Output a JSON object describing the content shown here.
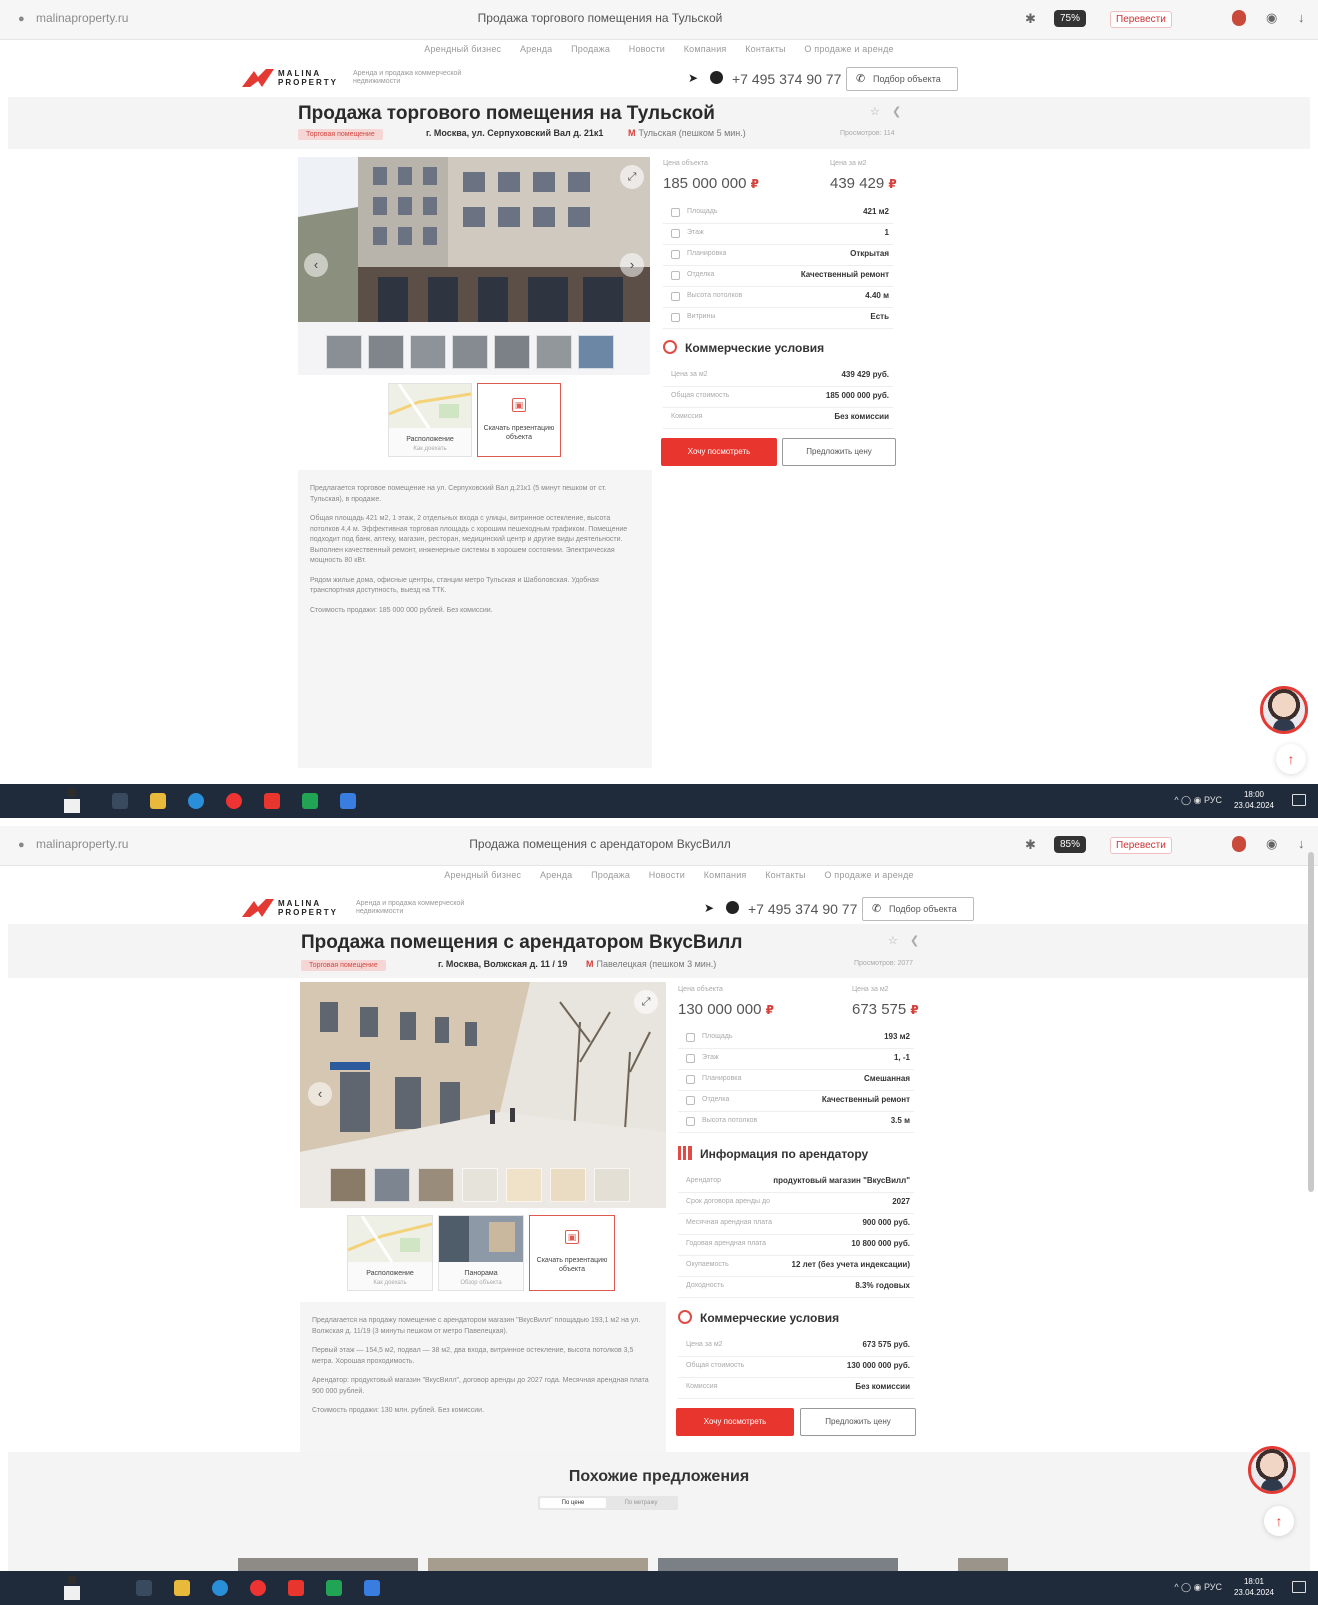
{
  "colors": {
    "accent": "#e8362f",
    "badge_bg": "#f6d6d4",
    "taskbar": "#1f2b3b"
  },
  "nav": [
    "Арендный бизнес",
    "Аренда",
    "Продажа",
    "Новости",
    "Компания",
    "Контакты",
    "О продаже и аренде"
  ],
  "site": {
    "logo_text": "MALINA PROPERTY",
    "tagline": "Аренда и продажа коммерческой недвижимости",
    "phone": "+7 495 374 90 77",
    "pick_button": "Подбор объекта"
  },
  "shot1": {
    "url": "malinaproperty.ru",
    "tab_title": "Продажа торгового помещения на Тульской",
    "perf": "75%",
    "translate": "Перевести",
    "title": "Продажа торгового помещения на Тульской",
    "type_badge": "Торговая помещение",
    "address": "г. Москва, ул. Серпуховский Вал д. 21к1",
    "metro": "Тульская (пешком 5 мин.)",
    "views": "Просмотров: 114",
    "price_label": "Цена объекта",
    "price": "185 000 000",
    "price_m2_label": "Цена за м2",
    "price_m2": "439 429",
    "rows": [
      {
        "k": "Площадь",
        "v": "421 м2"
      },
      {
        "k": "Этаж",
        "v": "1"
      },
      {
        "k": "Планировка",
        "v": "Открытая"
      },
      {
        "k": "Отделка",
        "v": "Качественный ремонт"
      },
      {
        "k": "Высота потолков",
        "v": "4.40 м"
      },
      {
        "k": "Витрины",
        "v": "Есть"
      }
    ],
    "commercial_title": "Коммерческие условия",
    "commercial": [
      {
        "k": "Цена за м2",
        "v": "439 429 руб."
      },
      {
        "k": "Общая стоимость",
        "v": "185 000 000 руб."
      },
      {
        "k": "Комиссия",
        "v": "Без комиссии"
      }
    ],
    "view_button": "Хочу посмотреть",
    "offer_button": "Предложить цену",
    "card_location": "Расположение",
    "card_location_sub": "Как доехать",
    "card_presentation": "Скачать презентацию объекта",
    "desc": [
      "Предлагается торговое помещение на ул. Серпуховский Вал д.21к1 (5 минут пешком от ст. Тульская), в продаже.",
      "Общая площадь 421 м2, 1 этаж, 2 отдельных входа с улицы, витринное остекление, высота потолков 4,4 м. Эффективная торговая площадь с хорошим пешеходным трафиком. Помещение подходит под банк, аптеку, магазин, ресторан, медицинский центр и другие виды деятельности. Выполнен качественный ремонт, инженерные системы в хорошем состоянии. Электрическая мощность 80 кВт.",
      "Рядом жилые дома, офисные центры, станции метро Тульская и Шаболовская. Удобная транспортная доступность, выезд на ТТК.",
      "Стоимость продажи: 185 000 000 рублей. Без комиссии."
    ],
    "tray": "РУС",
    "clock_time": "18:00",
    "clock_date": "23.04.2024"
  },
  "shot2": {
    "url": "malinaproperty.ru",
    "tab_title": "Продажа помещения с арендатором ВкусВилл",
    "perf": "85%",
    "translate": "Перевести",
    "title": "Продажа помещения с арендатором ВкусВилл",
    "type_badge": "Торговая помещение",
    "address": "г. Москва, Волжская д. 11 / 19",
    "metro": "Павелецкая (пешком 3 мин.)",
    "views": "Просмотров: 2077",
    "price_label": "Цена объекта",
    "price": "130 000 000",
    "price_m2_label": "Цена за м2",
    "price_m2": "673 575",
    "rows": [
      {
        "k": "Площадь",
        "v": "193 м2"
      },
      {
        "k": "Этаж",
        "v": "1, -1"
      },
      {
        "k": "Планировка",
        "v": "Смешанная"
      },
      {
        "k": "Отделка",
        "v": "Качественный ремонт"
      },
      {
        "k": "Высота потолков",
        "v": "3.5 м"
      }
    ],
    "tenant_title": "Информация по арендатору",
    "tenant": [
      {
        "k": "Арендатор",
        "v": "продуктовый магазин \"ВкусВилл\""
      },
      {
        "k": "Срок договора аренды до",
        "v": "2027"
      },
      {
        "k": "Месячная арендная плата",
        "v": "900 000 руб."
      },
      {
        "k": "Годовая арендная плата",
        "v": "10 800 000 руб."
      },
      {
        "k": "Окупаемость",
        "v": "12 лет (без учета индексации)"
      },
      {
        "k": "Доходность",
        "v": "8.3% годовых"
      }
    ],
    "commercial_title": "Коммерческие условия",
    "commercial": [
      {
        "k": "Цена за м2",
        "v": "673 575 руб."
      },
      {
        "k": "Общая стоимость",
        "v": "130 000 000 руб."
      },
      {
        "k": "Комиссия",
        "v": "Без комиссии"
      }
    ],
    "view_button": "Хочу посмотреть",
    "offer_button": "Предложить цену",
    "card_location": "Расположение",
    "card_location_sub": "Как доехать",
    "card_panorama": "Панорама",
    "card_panorama_sub": "Обзор объекта",
    "card_presentation": "Скачать презентацию объекта",
    "desc": [
      "Предлагается на продажу помещение с арендатором магазин \"ВкусВилл\" площадью 193,1 м2 на ул. Волжская д. 11/19 (3 минуты пешком от метро Павелецкая).",
      "Первый этаж — 154,5 м2, подвал — 38 м2, два входа, витринное остекление, высота потолков 3,5 метра. Хорошая проходимость.",
      "Арендатор: продуктовый магазин \"ВкусВилл\", договор аренды до 2027 года. Месячная арендная плата 900 000 рублей.",
      "Стоимость продажи: 130 млн. рублей. Без комиссии."
    ],
    "similar_title": "Похожие предложения",
    "similar_tabs": [
      "По цене",
      "По метражу"
    ],
    "tray": "РУС",
    "clock_time": "18:01",
    "clock_date": "23.04.2024"
  }
}
